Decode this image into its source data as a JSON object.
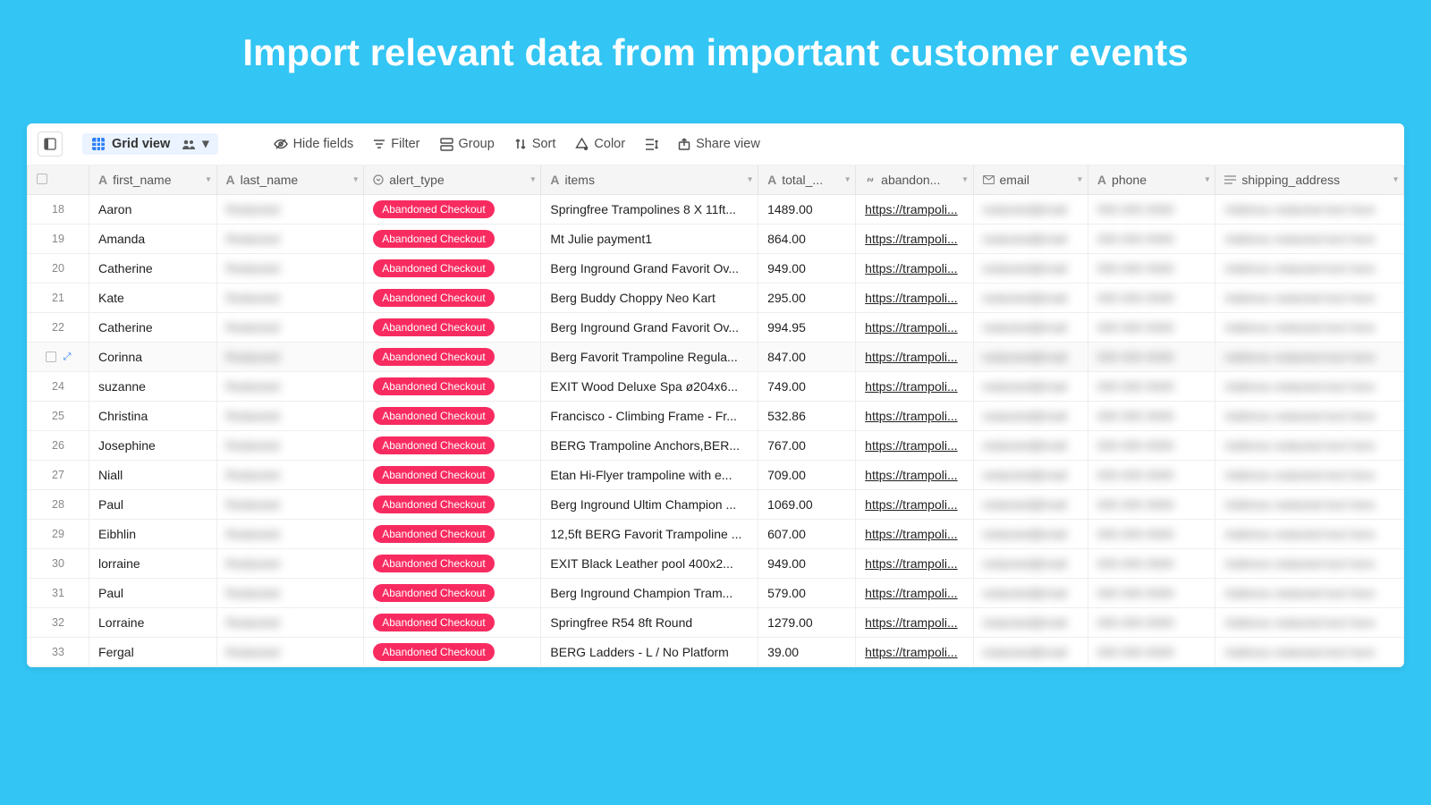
{
  "title": "Import relevant data from important customer events",
  "toolbar": {
    "view_label": "Grid view",
    "hide_fields": "Hide fields",
    "filter": "Filter",
    "group": "Group",
    "sort": "Sort",
    "color": "Color",
    "share": "Share view"
  },
  "columns": {
    "first_name": "first_name",
    "last_name": "last_name",
    "alert_type": "alert_type",
    "items": "items",
    "total": "total_...",
    "abandon": "abandon...",
    "email": "email",
    "phone": "phone",
    "shipping": "shipping_address"
  },
  "alert_label": "Abandoned Checkout",
  "link_text": "https://trampoli...",
  "rows": [
    {
      "n": "18",
      "first": "Aaron",
      "items": "Springfree Trampolines 8 X 11ft...",
      "total": "1489.00"
    },
    {
      "n": "19",
      "first": "Amanda",
      "items": "Mt Julie payment1",
      "total": "864.00"
    },
    {
      "n": "20",
      "first": "Catherine",
      "items": "Berg Inground Grand Favorit Ov...",
      "total": "949.00"
    },
    {
      "n": "21",
      "first": "Kate",
      "items": "Berg Buddy Choppy Neo Kart",
      "total": "295.00"
    },
    {
      "n": "22",
      "first": "Catherine",
      "items": "Berg Inground Grand Favorit Ov...",
      "total": "994.95"
    },
    {
      "n": "",
      "first": "Corinna",
      "items": "Berg Favorit Trampoline Regula...",
      "total": "847.00",
      "active": true
    },
    {
      "n": "24",
      "first": "suzanne",
      "items": "EXIT Wood Deluxe Spa ø204x6...",
      "total": "749.00"
    },
    {
      "n": "25",
      "first": "Christina",
      "items": "Francisco - Climbing Frame - Fr...",
      "total": "532.86"
    },
    {
      "n": "26",
      "first": "Josephine",
      "items": "BERG Trampoline Anchors,BER...",
      "total": "767.00"
    },
    {
      "n": "27",
      "first": "Niall",
      "items": "Etan Hi-Flyer trampoline with e...",
      "total": "709.00"
    },
    {
      "n": "28",
      "first": "Paul",
      "items": "Berg Inground Ultim Champion ...",
      "total": "1069.00"
    },
    {
      "n": "29",
      "first": "Eibhlin",
      "items": "12,5ft BERG Favorit Trampoline ...",
      "total": "607.00"
    },
    {
      "n": "30",
      "first": "lorraine",
      "items": "EXIT Black Leather pool 400x2...",
      "total": "949.00"
    },
    {
      "n": "31",
      "first": "Paul",
      "items": "Berg Inground Champion Tram...",
      "total": "579.00"
    },
    {
      "n": "32",
      "first": "Lorraine",
      "items": "Springfree R54 8ft Round",
      "total": "1279.00"
    },
    {
      "n": "33",
      "first": "Fergal",
      "items": "BERG Ladders - L / No Platform",
      "total": "39.00"
    }
  ]
}
